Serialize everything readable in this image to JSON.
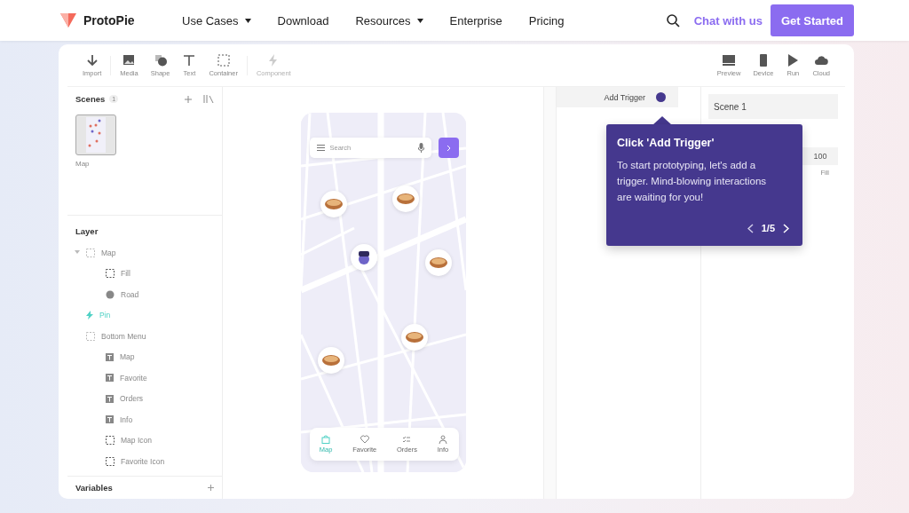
{
  "header": {
    "brand": "ProtoPie",
    "nav": [
      {
        "label": "Use Cases",
        "dropdown": true
      },
      {
        "label": "Download",
        "dropdown": false
      },
      {
        "label": "Resources",
        "dropdown": true
      },
      {
        "label": "Enterprise",
        "dropdown": false
      },
      {
        "label": "Pricing",
        "dropdown": false
      }
    ],
    "chat": "Chat with us",
    "cta": "Get Started"
  },
  "toolbar": {
    "left": [
      {
        "label": "Import",
        "kind": "import",
        "disabled": false
      },
      {
        "label": "Media",
        "kind": "media",
        "disabled": false
      },
      {
        "label": "Shape",
        "kind": "shape",
        "disabled": false
      },
      {
        "label": "Text",
        "kind": "text",
        "disabled": false
      },
      {
        "label": "Container",
        "kind": "container",
        "disabled": false
      },
      {
        "label": "Component",
        "kind": "component",
        "disabled": true
      }
    ],
    "right": [
      {
        "label": "Preview",
        "kind": "preview"
      },
      {
        "label": "Device",
        "kind": "device"
      },
      {
        "label": "Run",
        "kind": "run"
      },
      {
        "label": "Cloud",
        "kind": "cloud"
      }
    ]
  },
  "scenes": {
    "title": "Scenes",
    "count": "1",
    "items": [
      {
        "label": "Map",
        "selected": true
      }
    ]
  },
  "layers": {
    "title": "Layer",
    "items": [
      {
        "label": "Map",
        "kind": "container",
        "selected": false,
        "expanded": true,
        "children": [
          {
            "label": "Fill",
            "kind": "fill",
            "selected": false
          },
          {
            "label": "Road",
            "kind": "shape",
            "selected": false
          }
        ]
      },
      {
        "label": "Pin",
        "kind": "component",
        "selected": true
      },
      {
        "label": "Bottom Menu",
        "kind": "container",
        "selected": false,
        "children": [
          {
            "label": "Map",
            "kind": "text",
            "selected": false
          },
          {
            "label": "Favorite",
            "kind": "text",
            "selected": false
          },
          {
            "label": "Orders",
            "kind": "text",
            "selected": false
          },
          {
            "label": "Info",
            "kind": "text",
            "selected": false
          },
          {
            "label": "Map Icon",
            "kind": "fill",
            "selected": false
          },
          {
            "label": "Favorite Icon",
            "kind": "fill",
            "selected": false
          }
        ]
      }
    ]
  },
  "variables": {
    "title": "Variables"
  },
  "phone": {
    "search_placeholder": "Search",
    "nav": [
      {
        "label": "Map",
        "selected": true
      },
      {
        "label": "Favorite",
        "selected": false
      },
      {
        "label": "Orders",
        "selected": false
      },
      {
        "label": "Info",
        "selected": false
      }
    ]
  },
  "interaction": {
    "trigger": "Add Trigger"
  },
  "properties": {
    "scene": "Scene 1",
    "opacity": "100",
    "opacity_label": "Fill"
  },
  "tooltip": {
    "title": "Click 'Add Trigger'",
    "body": "To start prototyping, let's add a trigger. Mind-blowing interactions are waiting for you!",
    "page": "1/5"
  }
}
